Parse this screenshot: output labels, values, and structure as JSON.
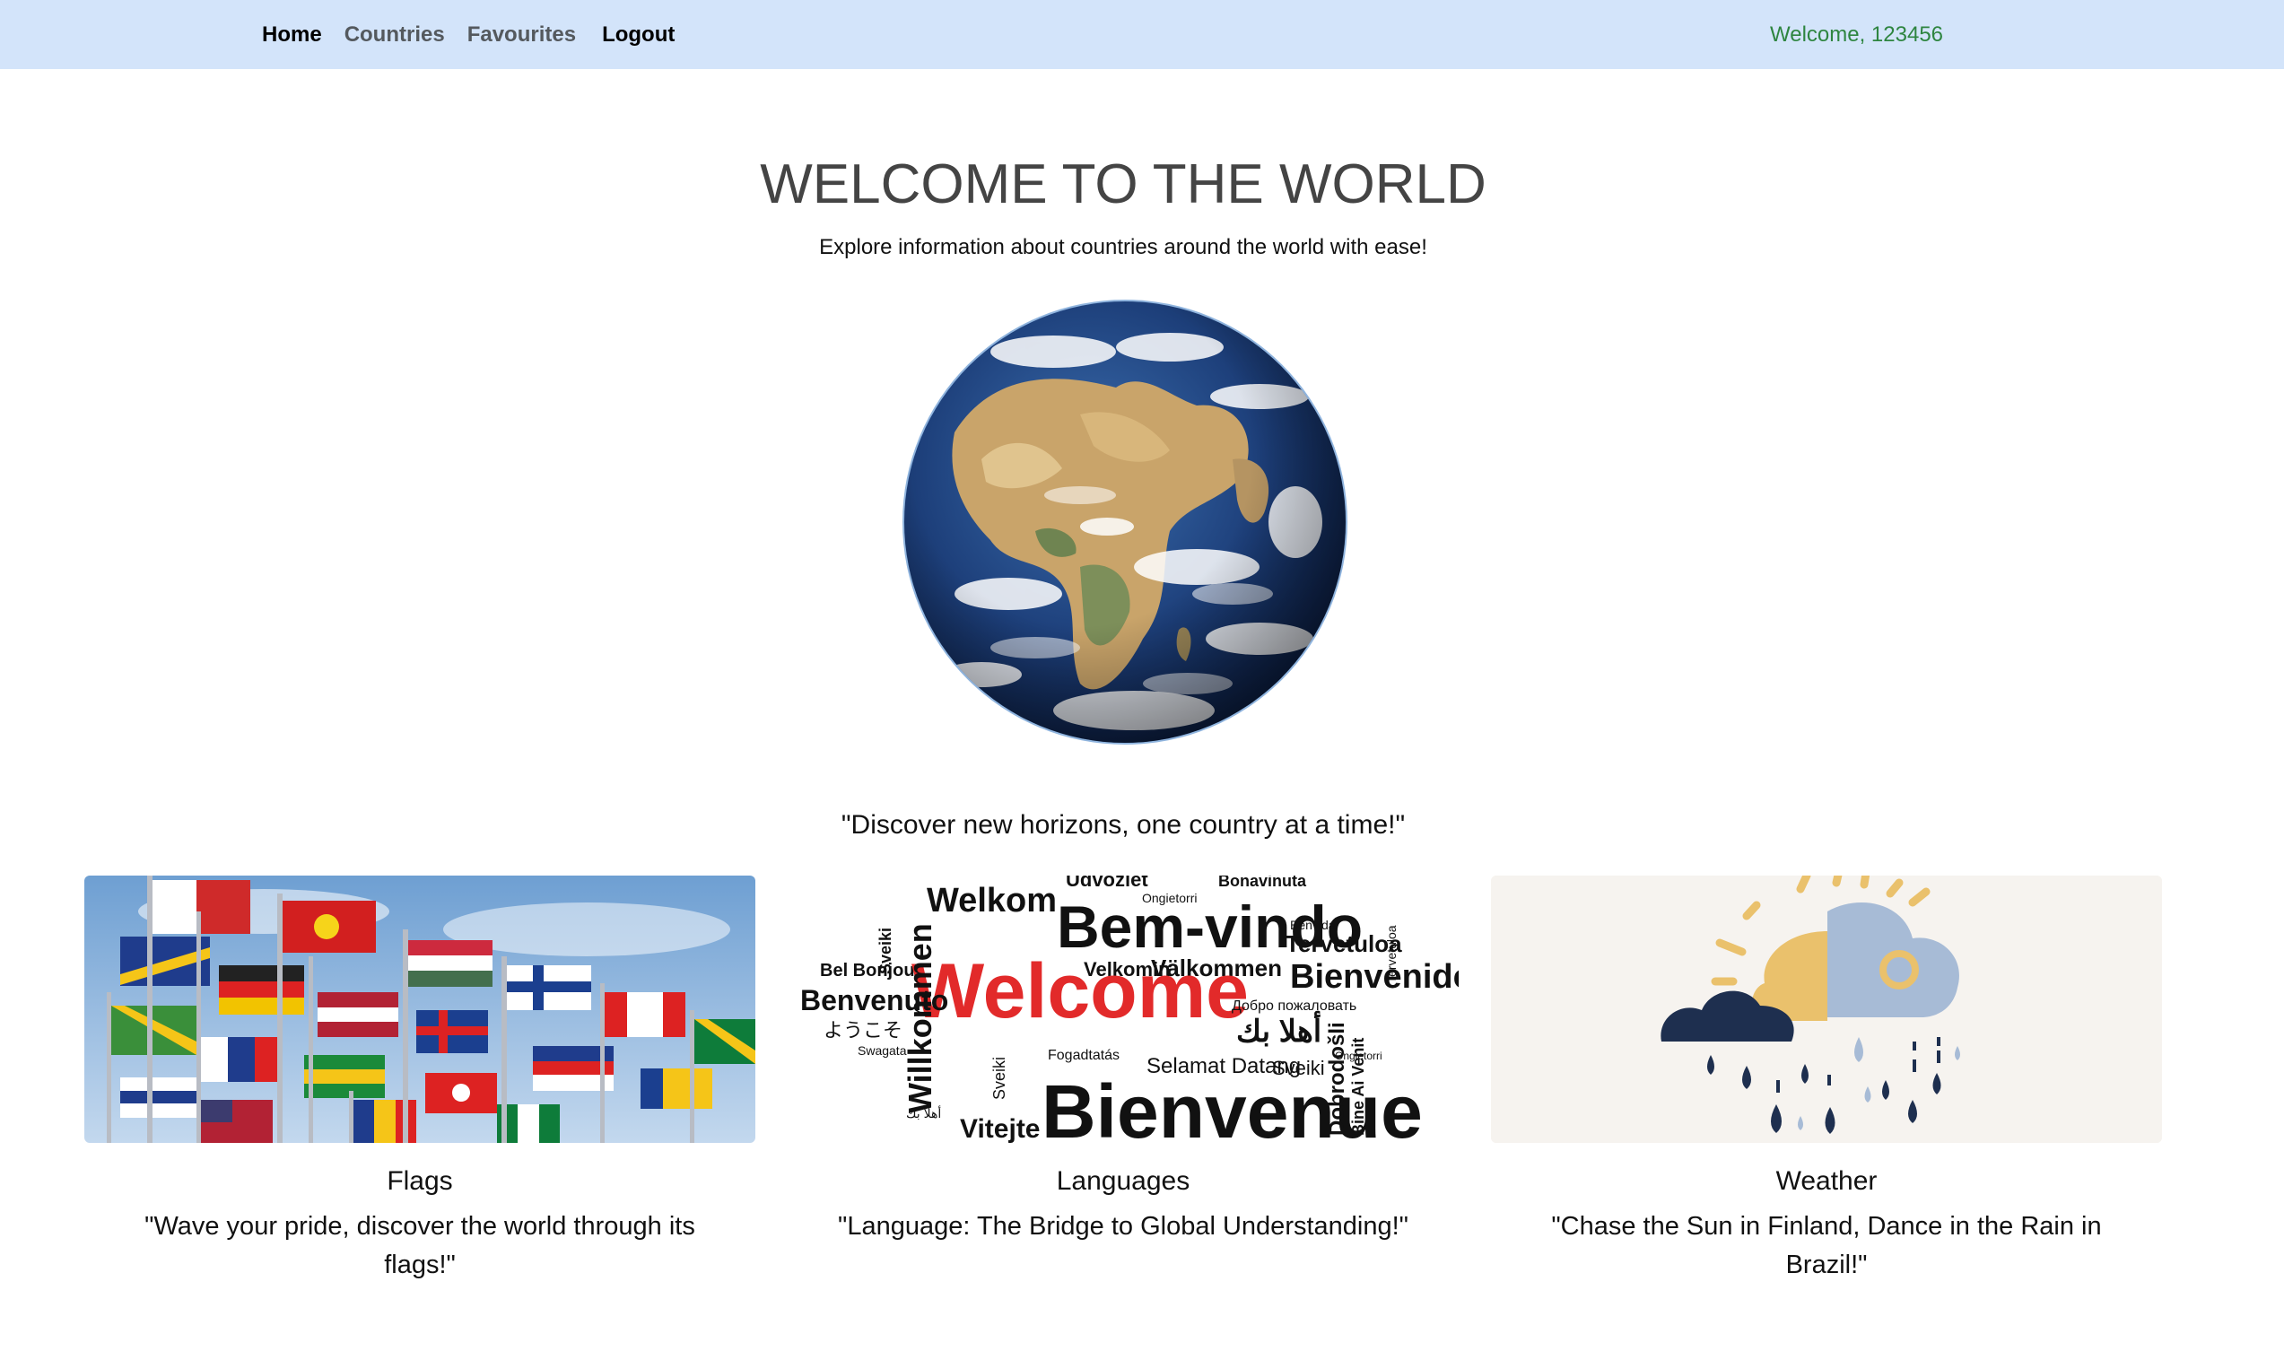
{
  "nav": {
    "items": [
      {
        "label": "Home",
        "active": true
      },
      {
        "label": "Countries",
        "active": false
      },
      {
        "label": "Favourites",
        "active": false
      }
    ],
    "logout_label": "Logout",
    "welcome_text": "Welcome, 123456"
  },
  "hero": {
    "title": "WELCOME TO THE WORLD",
    "subtitle": "Explore information about countries around the world with ease!",
    "tagline": "\"Discover new horizons, one country at a time!\""
  },
  "cards": [
    {
      "title": "Flags",
      "text": "\"Wave your pride, discover the world through its flags!\"",
      "image": "waving-flags-photo"
    },
    {
      "title": "Languages",
      "text": "\"Language: The Bridge to Global Understanding!\"",
      "image": "welcome-word-cloud"
    },
    {
      "title": "Weather",
      "text": "\"Chase the Sun in Finland, Dance in the Rain in Brazil!\"",
      "image": "sun-clouds-rain-illustration"
    }
  ],
  "word_cloud": {
    "main": "Welcome",
    "words": [
      "Bem-vindo",
      "Bienvenue",
      "Willkommen",
      "Bienvenido",
      "Welkom",
      "Benvenuto",
      "Välkommen",
      "Tervetuloa",
      "Vitejte",
      "Dobrodošli",
      "Bel Bonjou",
      "Selamat Datang",
      "Sveiki",
      "Velkomin",
      "Swagata",
      "Bine Ai Venit",
      "ようこそ",
      "أهلا بك",
      "Üdvözlet",
      "Bonavinuta",
      "Fogadtatás",
      "Benvida",
      "Ongietorri",
      "Добро пожаловать"
    ]
  },
  "colors": {
    "navbar_bg": "#d3e4fa",
    "welcome_green": "#2e8540",
    "word_red": "#e22a2a"
  }
}
